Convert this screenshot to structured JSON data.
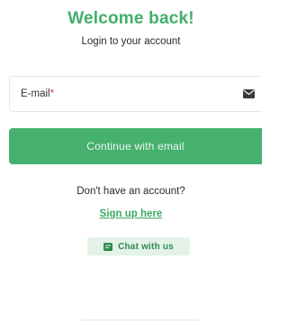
{
  "header": {
    "title": "Welcome back!",
    "subtitle": "Login to your account"
  },
  "email": {
    "label": "E-mail",
    "required_mark": "*",
    "icon": "envelope-icon"
  },
  "continue_button": {
    "label": "Continue with email"
  },
  "signup": {
    "prompt": "Don't have an account?",
    "link_label": "Sign up here"
  },
  "chat": {
    "label": "Chat with us",
    "icon": "chat-icon"
  },
  "colors": {
    "accent": "#46b06e",
    "title": "#40b06a",
    "required": "#e0313b",
    "chat_bg": "#e3f3e8"
  }
}
